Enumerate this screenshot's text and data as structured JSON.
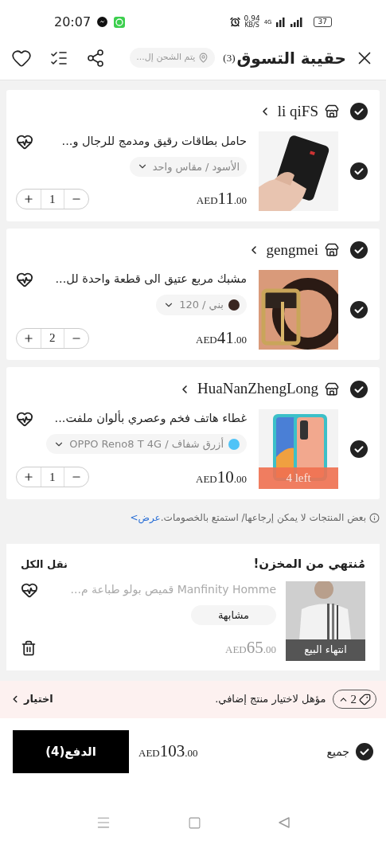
{
  "status_bar": {
    "time": "20:07",
    "speed": "0.94",
    "speed_unit": "KB/S",
    "network": "4G",
    "battery": "37"
  },
  "header": {
    "title": "حقيبة التسوق",
    "count": "(3)",
    "location": "يتم الشحن إل..."
  },
  "stores": [
    {
      "name": "li qiFS",
      "checked": true,
      "items": [
        {
          "title": "حامل بطاقات رقيق ومدمج للرجال و...",
          "variant": "الأسود / مقاس واحد",
          "price": {
            "currency": "AED",
            "whole": "11",
            "fraction": ".00"
          },
          "quantity": "1",
          "checked": true
        }
      ]
    },
    {
      "name": "gengmei",
      "checked": true,
      "items": [
        {
          "title": "مشبك مربع عتيق الى قطعة واحدة لل...",
          "variant": "بني / 120",
          "color": "#3a2620",
          "price": {
            "currency": "AED",
            "whole": "41",
            "fraction": ".00"
          },
          "quantity": "2",
          "checked": true
        }
      ]
    },
    {
      "name": "HuaNanZhengLong",
      "checked": true,
      "items": [
        {
          "title": "غطاء هاتف فخم وعصري بألوان ملفت...",
          "variant": "أزرق شفاف / OPPO Reno8 T 4G",
          "color": "#4fc3f7",
          "price": {
            "currency": "AED",
            "whole": "10",
            "fraction": ".00"
          },
          "quantity": "1",
          "checked": true,
          "stock": "4 left"
        }
      ]
    }
  ],
  "notice": {
    "text": "بعض المنتجات لا يمكن إرجاعها/ استمتع بالخصومات.",
    "link": "عرض>"
  },
  "sold_out": {
    "title": "مُنتهي من المخزن!",
    "action": "نقل الكل",
    "items": [
      {
        "title": "Manfinity Homme قميص بولو طباعة م...",
        "button": "مشابهة",
        "price": {
          "currency": "AED",
          "whole": "65",
          "fraction": ".00"
        },
        "badge": "انتهاء البيع"
      }
    ]
  },
  "promo": {
    "count": "2",
    "text": "مؤهل لاختيار منتج إضافي.",
    "action": "اختيار"
  },
  "footer": {
    "select_all": {
      "label": "جميع",
      "checked": true
    },
    "total": {
      "currency": "AED",
      "whole": "103",
      "fraction": ".00"
    },
    "pay_button": "الدفع(4)"
  }
}
